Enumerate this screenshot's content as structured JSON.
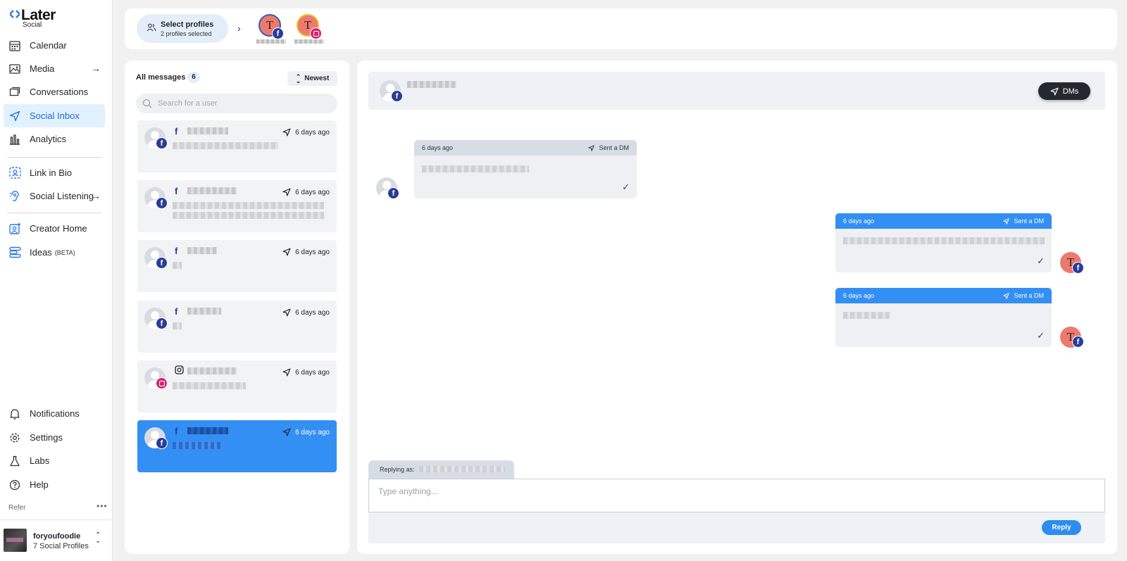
{
  "app": {
    "logo": "Later",
    "logo_sub": "Social"
  },
  "sidebar": {
    "items": [
      {
        "label": "Calendar",
        "icon": "calendar-icon"
      },
      {
        "label": "Media",
        "icon": "image-icon"
      },
      {
        "label": "Conversations",
        "icon": "chat-icon"
      },
      {
        "label": "Social Inbox",
        "icon": "send-icon"
      },
      {
        "label": "Analytics",
        "icon": "bar-chart-icon"
      },
      {
        "label": "Link in Bio",
        "icon": "link-in-bio-icon"
      },
      {
        "label": "Social Listening",
        "icon": "ear-icon"
      },
      {
        "label": "Creator Home",
        "icon": "creator-icon"
      },
      {
        "label": "Ideas",
        "icon": "ideas-icon",
        "badge": "(BETA)"
      },
      {
        "label": "Notifications",
        "icon": "bell-icon"
      },
      {
        "label": "Settings",
        "icon": "gear-icon"
      },
      {
        "label": "Labs",
        "icon": "flask-icon"
      },
      {
        "label": "Help",
        "icon": "help-icon"
      }
    ],
    "refer": "Refer",
    "more": "•••",
    "account": {
      "name": "foryoufoodie",
      "sub": "7 Social Profiles"
    }
  },
  "topbar": {
    "select_title": "Select profiles",
    "select_sub": "2 profiles selected",
    "profiles": [
      {
        "initial": "T",
        "platform": "facebook"
      },
      {
        "initial": "T",
        "platform": "instagram"
      }
    ]
  },
  "list": {
    "title": "All messages",
    "count": "6",
    "sort": "Newest",
    "search_placeholder": "Search for a user",
    "messages": [
      {
        "platform": "f",
        "time": "6 days ago"
      },
      {
        "platform": "f",
        "time": "6 days ago"
      },
      {
        "platform": "f",
        "time": "6 days ago"
      },
      {
        "platform": "f",
        "time": "6 days ago"
      },
      {
        "platform": "ig",
        "time": "6 days ago"
      },
      {
        "platform": "f",
        "time": "6 days ago",
        "selected": true
      }
    ]
  },
  "conversation": {
    "dms_label": "DMs",
    "bubbles": [
      {
        "time": "6 days ago",
        "status": "Sent a DM",
        "direction": "in"
      },
      {
        "time": "6 days ago",
        "status": "Sent a DM",
        "direction": "out"
      },
      {
        "time": "6 days ago",
        "status": "Sent a DM",
        "direction": "out"
      }
    ],
    "out_initial": "T",
    "replying_as": "Replying as:",
    "reply_placeholder": "Type anything...",
    "reply_button": "Reply"
  },
  "colors": {
    "accent": "#338ff3",
    "facebook": "#283d99",
    "instagram": "#d6246f",
    "active_nav_bg": "#e2f1fe"
  }
}
